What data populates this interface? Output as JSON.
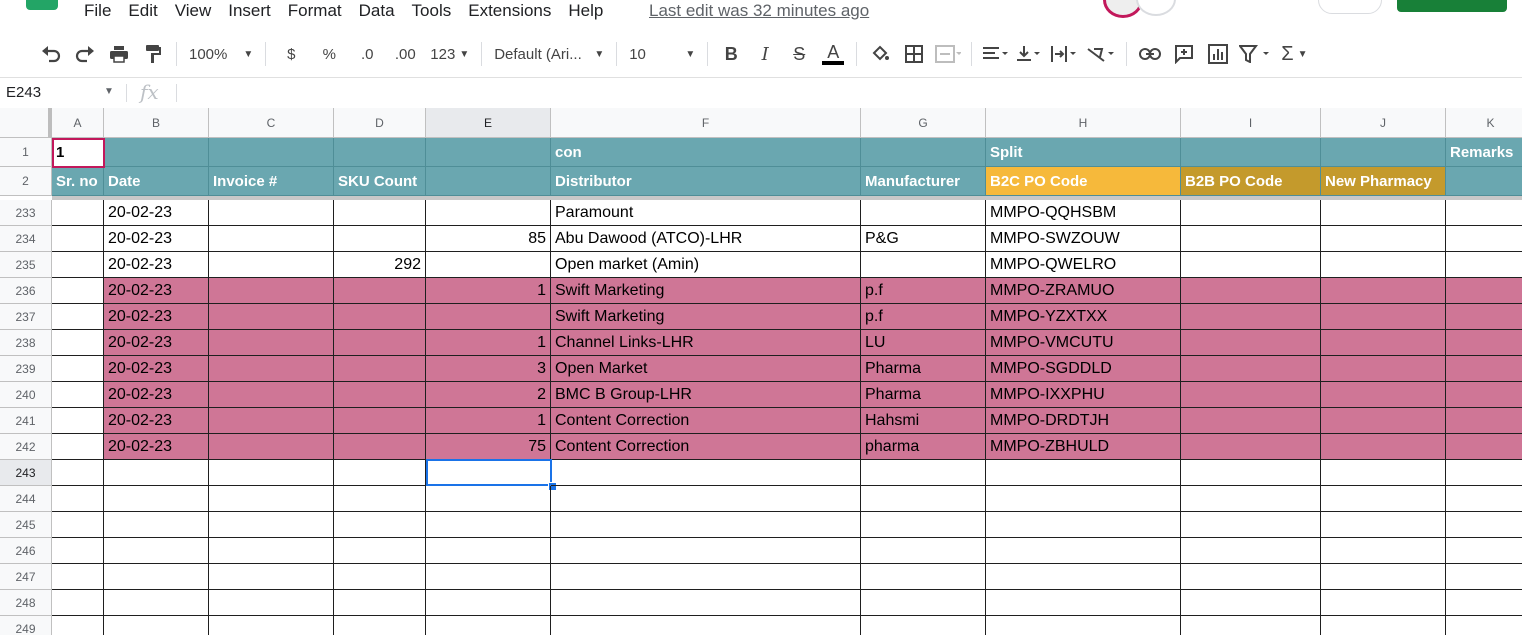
{
  "menu": {
    "items": [
      "File",
      "Edit",
      "View",
      "Insert",
      "Format",
      "Data",
      "Tools",
      "Extensions",
      "Help"
    ],
    "last_edit": "Last edit was 32 minutes ago"
  },
  "toolbar": {
    "zoom": "100%",
    "currency": "$",
    "percent": "%",
    "decrease_decimal": ".0",
    "increase_decimal": ".00",
    "more_formats": "123",
    "font": "Default (Ari...",
    "font_size": "10"
  },
  "formula_bar": {
    "name_box": "E243",
    "fx": "fx"
  },
  "columns": [
    {
      "label": "A"
    },
    {
      "label": "B"
    },
    {
      "label": "C"
    },
    {
      "label": "D"
    },
    {
      "label": "E"
    },
    {
      "label": "F"
    },
    {
      "label": "G"
    },
    {
      "label": "H"
    },
    {
      "label": "I"
    },
    {
      "label": "J"
    },
    {
      "label": "K"
    }
  ],
  "header_rows": [
    {
      "row": "1",
      "cells": [
        "1",
        "",
        "",
        "",
        "",
        "con",
        "",
        "Split",
        "",
        "",
        "Remarks"
      ]
    },
    {
      "row": "2",
      "cells": [
        "Sr. no",
        "Date",
        "Invoice #",
        "SKU Count",
        "",
        "Distributor",
        "Manufacturer",
        "B2C PO Code",
        "B2B PO Code",
        "New Pharmacy",
        ""
      ]
    }
  ],
  "data_rows": [
    {
      "row": "233",
      "highlight": false,
      "cells": [
        "",
        "20-02-23",
        "",
        "",
        "",
        "Paramount",
        "",
        "MMPO-QQHSBM",
        "",
        "",
        ""
      ]
    },
    {
      "row": "234",
      "highlight": false,
      "cells": [
        "",
        "20-02-23",
        "",
        "",
        "85",
        "Abu Dawood (ATCO)-LHR",
        "P&G",
        "MMPO-SWZOUW",
        "",
        "",
        ""
      ]
    },
    {
      "row": "235",
      "highlight": false,
      "cells": [
        "",
        "20-02-23",
        "",
        "292",
        "",
        "Open market (Amin)",
        "",
        "MMPO-QWELRO",
        "",
        "",
        ""
      ]
    },
    {
      "row": "236",
      "highlight": true,
      "cells": [
        "",
        "20-02-23",
        "",
        "",
        "1",
        "Swift Marketing",
        "p.f",
        "MMPO-ZRAMUO",
        "",
        "",
        ""
      ]
    },
    {
      "row": "237",
      "highlight": true,
      "cells": [
        "",
        "20-02-23",
        "",
        "",
        "",
        "Swift Marketing",
        "p.f",
        "MMPO-YZXTXX",
        "",
        "",
        ""
      ]
    },
    {
      "row": "238",
      "highlight": true,
      "cells": [
        "",
        "20-02-23",
        "",
        "",
        "1",
        "Channel Links-LHR",
        "LU",
        "MMPO-VMCUTU",
        "",
        "",
        ""
      ]
    },
    {
      "row": "239",
      "highlight": true,
      "cells": [
        "",
        "20-02-23",
        "",
        "",
        "3",
        "Open Market",
        "Pharma",
        "MMPO-SGDDLD",
        "",
        "",
        ""
      ]
    },
    {
      "row": "240",
      "highlight": true,
      "cells": [
        "",
        "20-02-23",
        "",
        "",
        "2",
        "BMC B Group-LHR",
        "Pharma",
        "MMPO-IXXPHU",
        "",
        "",
        ""
      ]
    },
    {
      "row": "241",
      "highlight": true,
      "cells": [
        "",
        "20-02-23",
        "",
        "",
        "1",
        "Content Correction",
        "Hahsmi",
        "MMPO-DRDTJH",
        "",
        "",
        ""
      ]
    },
    {
      "row": "242",
      "highlight": true,
      "cells": [
        "",
        "20-02-23",
        "",
        "",
        "75",
        "Content Correction",
        "pharma",
        "MMPO-ZBHULD",
        "",
        "",
        ""
      ]
    },
    {
      "row": "243",
      "highlight": false,
      "cells": [
        "",
        "",
        "",
        "",
        "",
        "",
        "",
        "",
        "",
        "",
        ""
      ]
    },
    {
      "row": "244",
      "highlight": false,
      "cells": [
        "",
        "",
        "",
        "",
        "",
        "",
        "",
        "",
        "",
        "",
        ""
      ]
    },
    {
      "row": "245",
      "highlight": false,
      "cells": [
        "",
        "",
        "",
        "",
        "",
        "",
        "",
        "",
        "",
        "",
        ""
      ]
    },
    {
      "row": "246",
      "highlight": false,
      "cells": [
        "",
        "",
        "",
        "",
        "",
        "",
        "",
        "",
        "",
        "",
        ""
      ]
    },
    {
      "row": "247",
      "highlight": false,
      "cells": [
        "",
        "",
        "",
        "",
        "",
        "",
        "",
        "",
        "",
        "",
        ""
      ]
    },
    {
      "row": "248",
      "highlight": false,
      "cells": [
        "",
        "",
        "",
        "",
        "",
        "",
        "",
        "",
        "",
        "",
        ""
      ]
    },
    {
      "row": "249",
      "highlight": false,
      "cells": [
        "",
        "",
        "",
        "",
        "",
        "",
        "",
        "",
        "",
        "",
        ""
      ]
    }
  ],
  "selected_cell": {
    "row": "243",
    "col": "E"
  },
  "colors": {
    "header_teal": "#6aa7b0",
    "header_yellow": "#f6b93b",
    "header_gold": "#c49a2c",
    "row_pink": "#cf7696",
    "selection_blue": "#1a73e8"
  }
}
